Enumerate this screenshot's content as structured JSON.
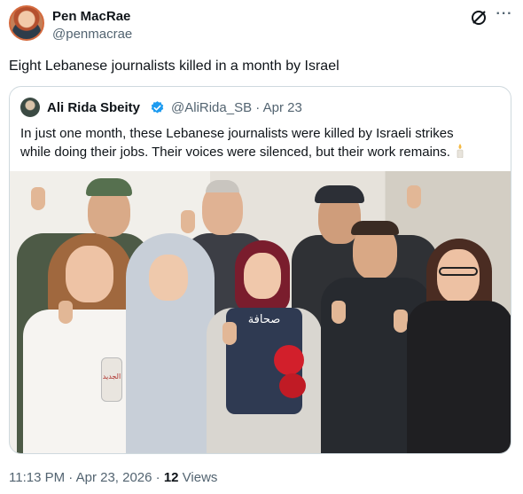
{
  "author": {
    "name": "Pen MacRae",
    "handle": "@penmacrae"
  },
  "post": {
    "text": "Eight Lebanese journalists killed in a month by Israel"
  },
  "quoted": {
    "name": "Ali Rida Sbeity",
    "handle_date": "@AliRida_SB · Apr 23",
    "text": "In just one month, these Lebanese journalists were killed by Israeli strikes while doing their jobs. Their voices were silenced, but their work remains.",
    "vest_text": "صحافة",
    "mic_text": "الجديد"
  },
  "meta": {
    "timestamp": "11:13 PM · Apr 23, 2026 · ",
    "views_count": "12",
    "views_label": " Views"
  },
  "icons": {
    "grok": "grok-icon",
    "more": "more-icon",
    "verified": "verified-icon",
    "candle": "candle-icon"
  },
  "colors": {
    "verified": "#1d9bf0",
    "secondary_text": "#536471",
    "border": "#cfd9de"
  }
}
